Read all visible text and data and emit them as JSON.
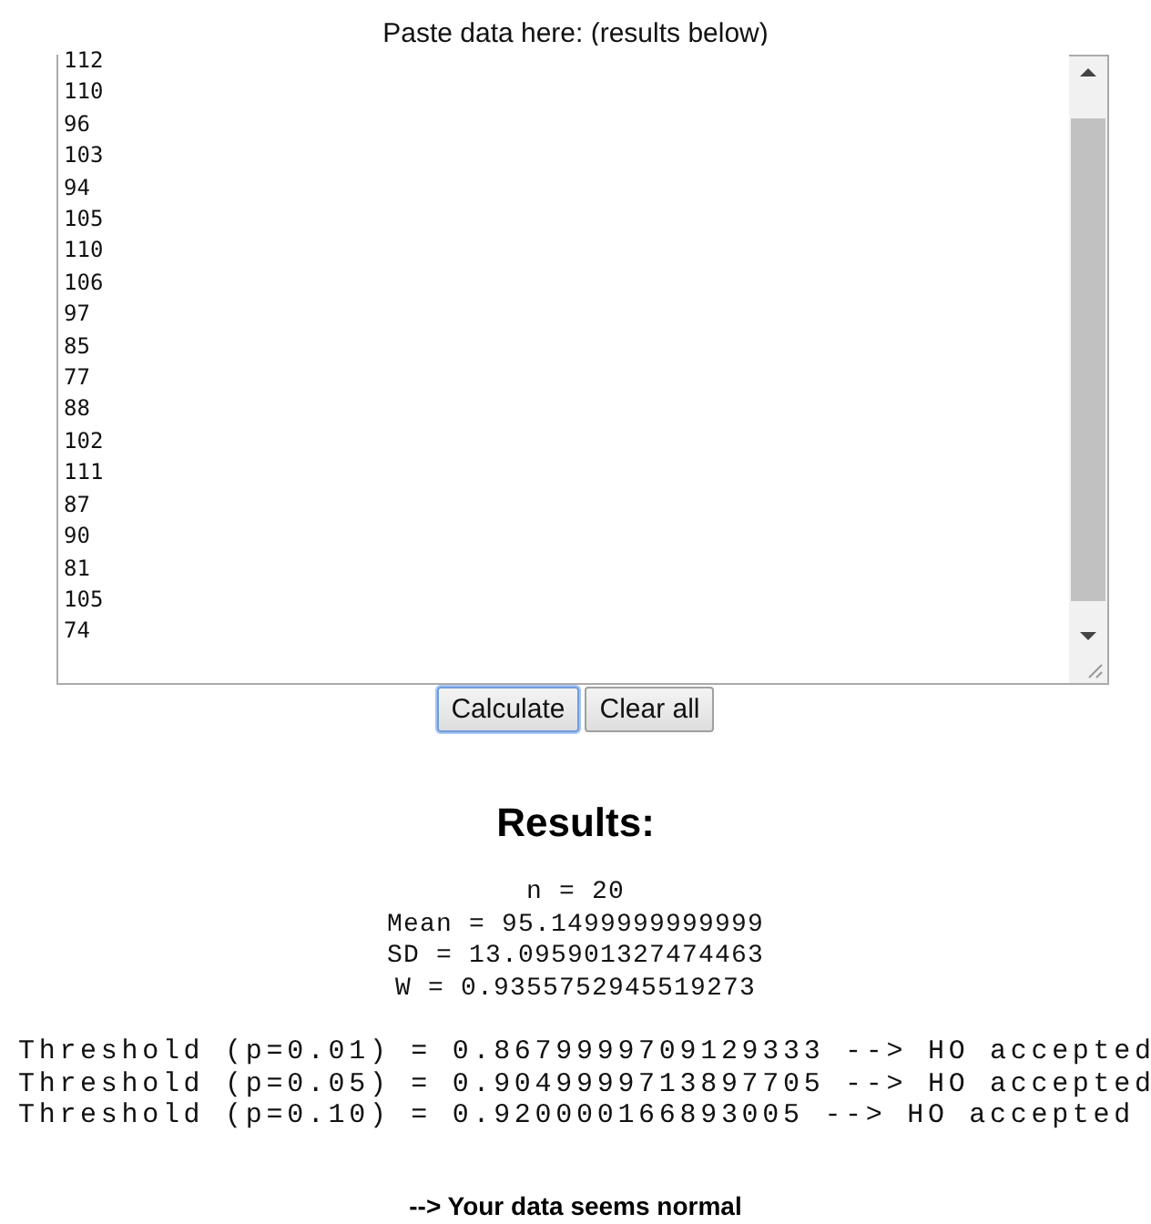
{
  "prompt": "Paste data here: (results below)",
  "data_field": {
    "value": "112\n110\n96\n103\n94\n105\n110\n106\n97\n85\n77\n88\n102\n111\n87\n90\n81\n105\n74"
  },
  "buttons": [
    {
      "label": "Calculate",
      "focused": true
    },
    {
      "label": "Clear all",
      "focused": false
    }
  ],
  "results": {
    "title": "Results:",
    "stats": [
      "n = 20",
      "Mean = 95.1499999999999",
      "SD = 13.095901327474463",
      "W = 0.9355752945519273"
    ],
    "thresholds": [
      "Threshold (p=0.01) = 0.8679999709129333 --> HO accepted",
      "Threshold (p=0.05) = 0.9049999713897705 --> HO accepted",
      "Threshold (p=0.10) = 0.920000166893005 --> HO accepted"
    ],
    "conclusion": "--> Your data seems normal"
  }
}
